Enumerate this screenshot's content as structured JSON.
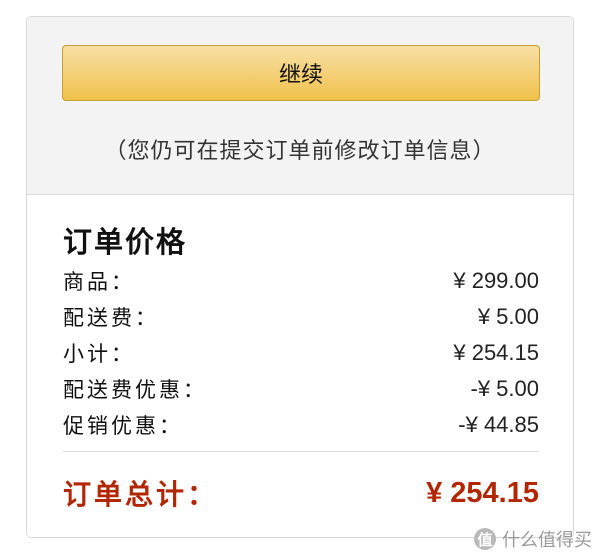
{
  "actions": {
    "continue_label": "继续",
    "note": "（您仍可在提交订单前修改订单信息）"
  },
  "summary": {
    "title": "订单价格",
    "rows": [
      {
        "label": "商品：",
        "value": "¥ 299.00"
      },
      {
        "label": "配送费：",
        "value": "¥ 5.00"
      },
      {
        "label": "小计：",
        "value": "¥ 254.15"
      },
      {
        "label": "配送费优惠：",
        "value": "-¥ 5.00"
      },
      {
        "label": "促销优惠：",
        "value": "-¥ 44.85"
      }
    ],
    "total": {
      "label": "订单总计：",
      "value": "¥ 254.15"
    }
  },
  "watermark": {
    "badge": "值",
    "text": "什么值得买"
  },
  "colors": {
    "button": "#f0c14b",
    "total": "#b12704"
  }
}
